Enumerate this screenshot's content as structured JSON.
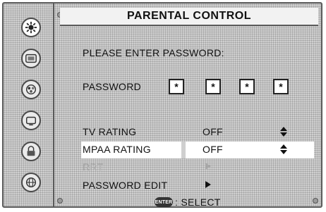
{
  "title": "PARENTAL CONTROL",
  "prompt": "PLEASE ENTER PASSWORD:",
  "password": {
    "label": "PASSWORD",
    "digits": [
      "*",
      "*",
      "*",
      "*"
    ]
  },
  "settings": [
    {
      "label": "TV RATING",
      "value": "OFF",
      "control": "updown-icon",
      "enabled": true,
      "selected": false
    },
    {
      "label": "MPAA RATING",
      "value": "OFF",
      "control": "updown-icon",
      "enabled": true,
      "selected": true
    },
    {
      "label": "RRT",
      "value": "",
      "control": "right-arrow-icon",
      "enabled": false,
      "selected": false
    },
    {
      "label": "PASSWORD EDIT",
      "value": "",
      "control": "right-arrow-icon",
      "enabled": true,
      "selected": false
    }
  ],
  "footer": {
    "enter_key": "ENTER",
    "hint": ": SELECT"
  },
  "sidebar_icons": [
    "settings-icon",
    "picture-icon",
    "audio-icon",
    "tv-icon",
    "lock-icon",
    "globe-icon"
  ]
}
